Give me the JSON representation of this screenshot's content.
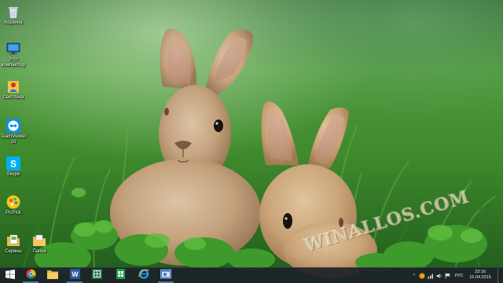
{
  "desktop": {
    "icons": [
      {
        "name": "recycle-bin",
        "label": "Корзина",
        "icon": "recycle-bin-icon"
      },
      {
        "name": "this-pc",
        "label": "Этот компьютер",
        "icon": "computer-icon"
      },
      {
        "name": "user-folder",
        "label": "Светлана",
        "icon": "user-folder-icon"
      },
      {
        "name": "teamviewer",
        "label": "TeamViewer 10",
        "icon": "teamviewer-icon"
      },
      {
        "name": "skype",
        "label": "Skype",
        "icon": "skype-icon"
      },
      {
        "name": "picpick",
        "label": "PicPick",
        "icon": "picpick-icon"
      },
      {
        "name": "screenshots",
        "label": "Скрины",
        "icon": "screenshot-folder-icon"
      },
      {
        "name": "folder",
        "label": "Папка",
        "icon": "folder-icon"
      }
    ],
    "watermark": "WINALLOS.COM"
  },
  "taskbar": {
    "start_icon": "windows-logo-icon",
    "pinned": [
      {
        "name": "chrome",
        "icon": "chrome-icon"
      },
      {
        "name": "explorer",
        "icon": "file-explorer-icon"
      },
      {
        "name": "word",
        "icon": "word-icon"
      },
      {
        "name": "excel",
        "icon": "excel-icon"
      },
      {
        "name": "sheets",
        "icon": "spreadsheet-icon"
      },
      {
        "name": "internet-explorer",
        "icon": "internet-explorer-icon"
      },
      {
        "name": "window-app",
        "icon": "window-app-icon"
      }
    ],
    "tray": {
      "language": "РУС",
      "time": "23:16",
      "date": "15.04.2015"
    }
  },
  "colors": {
    "taskbar_bg": "#1c2228",
    "accent": "#78beff"
  }
}
